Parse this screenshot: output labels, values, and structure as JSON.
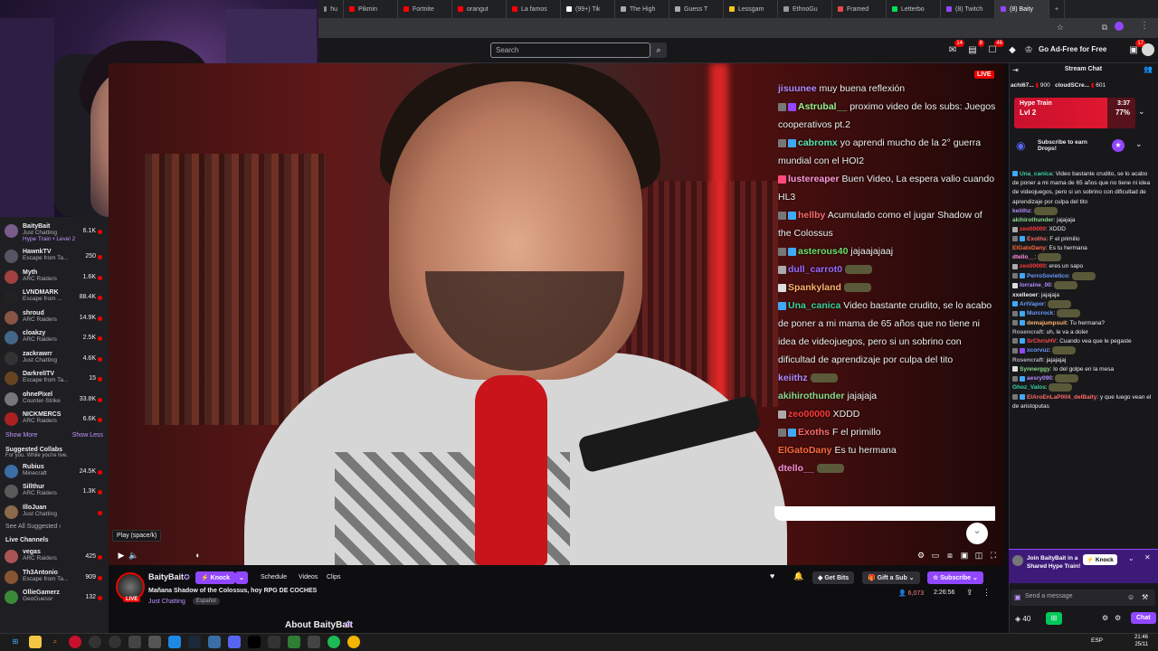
{
  "browser": {
    "tabs": [
      {
        "label": "hu",
        "color": "#888"
      },
      {
        "label": "Pikmin",
        "color": "#ff0000"
      },
      {
        "label": "Fortnite",
        "color": "#ff0000"
      },
      {
        "label": "orangut",
        "color": "#ff0000"
      },
      {
        "label": "La famos",
        "color": "#ff0000"
      },
      {
        "label": "(99+) Tik",
        "color": "#ffffff"
      },
      {
        "label": "The High",
        "color": "#aaa"
      },
      {
        "label": "Guess T",
        "color": "#aaa"
      },
      {
        "label": "Lessgam",
        "color": "#f5c518"
      },
      {
        "label": "EthnoGu",
        "color": "#999"
      },
      {
        "label": "Framed",
        "color": "#e84a4a"
      },
      {
        "label": "Letterbo",
        "color": "#00e054"
      },
      {
        "label": "(8) Twitch",
        "color": "#9147ff"
      },
      {
        "label": "(8) Baity",
        "color": "#9147ff"
      }
    ],
    "new_tab": "+"
  },
  "topnav": {
    "search_placeholder": "Search",
    "badges": [
      "14",
      "8",
      "46",
      "17"
    ],
    "ad_free": "Go Ad-Free for Free"
  },
  "sidebar": {
    "channels": [
      {
        "name": "BaityBait",
        "game": "Just Chatting",
        "viewers": "6.1K",
        "color": "#7a5c8a",
        "sub": "Hype Train • Level 2"
      },
      {
        "name": "HawnkTV",
        "game": "Escape from Ta...",
        "viewers": "250",
        "color": "#556"
      },
      {
        "name": "Myth",
        "game": "ARC Raiders",
        "viewers": "1.6K",
        "color": "#a04040"
      },
      {
        "name": "LVNDMARK",
        "game": "Escape from ...",
        "viewers": "88.4K",
        "color": "#222"
      },
      {
        "name": "shroud",
        "game": "ARC Raiders",
        "viewers": "14.9K",
        "color": "#885544"
      },
      {
        "name": "cloakzy",
        "game": "ARC Raiders",
        "viewers": "2.5K",
        "color": "#446688"
      },
      {
        "name": "zackrawrr",
        "game": "Just Chatting",
        "viewers": "4.6K",
        "color": "#333"
      },
      {
        "name": "DarkrelITV",
        "game": "Escape from Ta...",
        "viewers": "15",
        "color": "#664422"
      },
      {
        "name": "ohnePixel",
        "game": "Counter-Strike",
        "viewers": "33.8K",
        "color": "#777"
      },
      {
        "name": "NICKMERCS",
        "game": "ARC Raiders",
        "viewers": "6.6K",
        "color": "#aa2222"
      }
    ],
    "show_more": "Show More",
    "show_less": "Show Less",
    "suggested_title": "Suggested Collabs",
    "suggested_sub": "For you. While you're live.",
    "suggested": [
      {
        "name": "Rubius",
        "game": "Minecraft",
        "viewers": "24.5K",
        "color": "#3a6ea5"
      },
      {
        "name": "Sillthur",
        "game": "ARC Raiders",
        "viewers": "1.3K",
        "color": "#5a5a5a"
      },
      {
        "name": "IlloJuan",
        "game": "Just Chatting",
        "viewers": "",
        "color": "#8a6a4a"
      }
    ],
    "see_all": "See All Suggested",
    "live_title": "Live Channels",
    "live": [
      {
        "name": "vegas",
        "game": "ARC Raiders",
        "viewers": "425",
        "color": "#aa5555"
      },
      {
        "name": "Th3Antonio",
        "game": "Escape from Ta...",
        "viewers": "909",
        "color": "#885533"
      },
      {
        "name": "OllieGamerz",
        "game": "GeoGuessr",
        "viewers": "132",
        "color": "#3a8a3a"
      }
    ]
  },
  "video": {
    "live_label": "LIVE",
    "tooltip": "Play (space/k)"
  },
  "overlay_chat": [
    {
      "user": "",
      "color": "#ffffff",
      "text": "",
      "badges": []
    },
    {
      "user": "jisuunee",
      "color": "#b48bff",
      "text": "muy buena reflexión",
      "badges": []
    },
    {
      "user": "Astrubal__",
      "color": "#9af28f",
      "text": "proximo video de los subs: Juegos cooperativos pt.2",
      "badges": [
        "#777",
        "#9147ff"
      ]
    },
    {
      "user": "cabromx",
      "color": "#56e8b4",
      "text": "yo aprendi mucho de la 2° guerra mundial con el HOI2",
      "badges": [
        "#777",
        "#3fa9f5"
      ]
    },
    {
      "user": "lustereaper",
      "color": "#ff9ad8",
      "text": "Buen Video, La espera valio cuando HL3",
      "badges": [
        "#ff4a7a"
      ]
    },
    {
      "user": "hellby",
      "color": "#ff6a6a",
      "text": "Acumulado como el jugar Shadow of the Colossus",
      "badges": [
        "#777",
        "#3fa9f5"
      ]
    },
    {
      "user": "asterous40",
      "color": "#6adf6a",
      "text": "jajaajajaaj",
      "badges": [
        "#777",
        "#3fa9f5"
      ]
    },
    {
      "user": "dull_carrot0",
      "color": "#9b6bff",
      "text": "",
      "badges": [
        "#aaa"
      ]
    },
    {
      "user": "Spankyland",
      "color": "#ffb36b",
      "text": "",
      "badges": [
        "#ddd"
      ]
    },
    {
      "user": "Una_canica",
      "color": "#39d39d",
      "text": "Video bastante crudito, se lo acabo de poner a mi mama de 65 años que no tiene ni idea de videojuegos, pero si un sobrino con dificultad de aprendizaje por culpa del tito",
      "badges": [
        "#3fa9f5"
      ]
    },
    {
      "user": "keiithz",
      "color": "#b48bff",
      "text": "",
      "badges": []
    },
    {
      "user": "akihirothunder",
      "color": "#8ad98a",
      "text": "jajajaja",
      "badges": []
    },
    {
      "user": "zeo00000",
      "color": "#ff3a3a",
      "text": "XDDD",
      "badges": [
        "#aaa"
      ]
    },
    {
      "user": "Exoths",
      "color": "#ff6a6a",
      "text": "F el primillo",
      "badges": [
        "#777",
        "#3fa9f5"
      ]
    },
    {
      "user": "ElGatoDany",
      "color": "#ff6a3a",
      "text": "Es tu hermana",
      "badges": []
    },
    {
      "user": "dtello__",
      "color": "#ff8fd8",
      "text": "",
      "badges": []
    }
  ],
  "stream": {
    "channel": "BaityBait",
    "live_label": "LIVE",
    "knock": "Knock",
    "tabs": [
      "Schedule",
      "Videos",
      "Clips"
    ],
    "title": "Mañana Shadow of the Colossus, hoy RPG DE COCHES",
    "category": "Just Chatting",
    "tag": "Español",
    "get_bits": "Get Bits",
    "gift_sub": "Gift a Sub",
    "subscribe": "Subscribe",
    "viewers": "6,073",
    "uptime": "2:26:56",
    "about": "About BaityBait"
  },
  "chat": {
    "title": "Stream Chat",
    "leaderboard": [
      {
        "user": "achi67...",
        "amount": "900"
      },
      {
        "user": "cloudSCre...",
        "amount": "601"
      }
    ],
    "hype_train": {
      "title": "Hype Train",
      "level": "Lvl 2",
      "time": "3:37",
      "percent": "77%"
    },
    "drops": "Subscribe to earn Drops!",
    "messages": [
      {
        "user": "Una_canica",
        "color": "#39d39d",
        "text": "Video bastante crudito, se lo acabo de poner a mi mama de 65 años que no tiene ni idea de videojuegos, pero si un sobrino con dificultad de aprendizaje por culpa del tito",
        "badges": [
          "#3fa9f5"
        ]
      },
      {
        "user": "keiithz",
        "color": "#b48bff",
        "text": "",
        "badges": []
      },
      {
        "user": "akihirothunder",
        "color": "#8ad98a",
        "text": "jajajaja",
        "badges": []
      },
      {
        "user": "zeo00000",
        "color": "#ff3a3a",
        "text": "XDDD",
        "badges": [
          "#aaa"
        ]
      },
      {
        "user": "Exoths",
        "color": "#ff6a6a",
        "text": "F el primillo",
        "badges": [
          "#777",
          "#3fa9f5"
        ]
      },
      {
        "user": "ElGatoDany",
        "color": "#ff6a3a",
        "text": "Es tu hermana",
        "badges": []
      },
      {
        "user": "dtello__",
        "color": "#ff8fd8",
        "text": "",
        "badges": []
      },
      {
        "user": "zeo00000",
        "color": "#ff3a3a",
        "text": "eres un sapo",
        "badges": [
          "#aaa"
        ]
      },
      {
        "user": "PerroSovietico",
        "color": "#6a9bff",
        "text": "",
        "badges": [
          "#777",
          "#3fa9f5"
        ]
      },
      {
        "user": "lorraine_00",
        "color": "#b48bff",
        "text": "",
        "badges": [
          "#ddd"
        ]
      },
      {
        "user": "xxelleoer",
        "color": "#efeff1",
        "text": "jajajaja",
        "badges": []
      },
      {
        "user": "ArtVapor",
        "color": "#6a9bff",
        "text": "",
        "badges": [
          "#3fa9f5"
        ]
      },
      {
        "user": "Murcrock",
        "color": "#6a9bff",
        "text": "",
        "badges": [
          "#777",
          "#3fa9f5"
        ]
      },
      {
        "user": "demajumpsuit",
        "color": "#ffb36b",
        "text": "Tu hermana?",
        "badges": [
          "#777",
          "#3fa9f5"
        ]
      },
      {
        "user": "Rosencraft",
        "color": "#adadb8",
        "text": "uh, le va a doler",
        "badges": []
      },
      {
        "user": "SrChrisHV",
        "color": "#ff4a4a",
        "text": "Cuando vea que le pegaste",
        "badges": [
          "#777",
          "#3fa9f5"
        ]
      },
      {
        "user": "xcorvuz",
        "color": "#6a9bff",
        "text": "",
        "badges": [
          "#777",
          "#9147ff"
        ]
      },
      {
        "user": "Rosencraft",
        "color": "#adadb8",
        "text": "jajajajaj",
        "badges": []
      },
      {
        "user": "Synnerggy",
        "color": "#8ad98a",
        "text": "lo del golpe en la mesa",
        "badges": [
          "#ddd"
        ]
      },
      {
        "user": "aesry090",
        "color": "#b48bff",
        "text": "",
        "badges": [
          "#777",
          "#3fa9f5"
        ]
      },
      {
        "user": "Ghoz_Valos",
        "color": "#39d39d",
        "text": "",
        "badges": []
      },
      {
        "user": "ElAroEnLaP0ll4_delBaity",
        "color": "#ff6a6a",
        "text": "y que luego vean el de aristoputas",
        "badges": [
          "#777",
          "#3fa9f5"
        ]
      }
    ],
    "shared_hype": "Join BaityBait in a Shared Hype Train!",
    "knock": "Knock",
    "input_placeholder": "Send a message",
    "points": "40",
    "chat_btn": "Chat"
  },
  "taskbar": {
    "lang": "ESP",
    "time": "21:46",
    "date": "25/11"
  }
}
